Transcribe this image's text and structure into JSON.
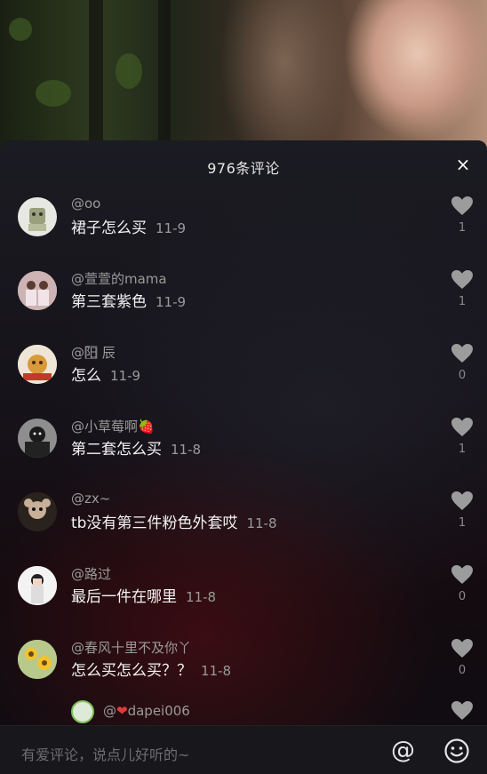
{
  "panel": {
    "title": "976条评论",
    "close_label": "×"
  },
  "comments": [
    {
      "username": "@oo",
      "text": "裙子怎么买",
      "date": "11-9",
      "likes": "1"
    },
    {
      "username": "@萱萱的mama",
      "text": "第三套紫色",
      "date": "11-9",
      "likes": "1"
    },
    {
      "username": "@阳⃞ 辰",
      "text": "怎么",
      "date": "11-9",
      "likes": "0"
    },
    {
      "username": "@小草莓啊🍓",
      "text": "第二套怎么买",
      "date": "11-8",
      "likes": "1"
    },
    {
      "username": "@zx~",
      "text": "tb没有第三件粉色外套哎",
      "date": "11-8",
      "likes": "1"
    },
    {
      "username": "@路过",
      "text": "最后一件在哪里",
      "date": "11-8",
      "likes": "0"
    },
    {
      "username": "@春风十里不及你丫",
      "text": "怎么买怎么买？？",
      "date": "11-8",
      "likes": "0"
    }
  ],
  "reply": {
    "prefix": "@",
    "heart": "❤",
    "name": "dapei006"
  },
  "input": {
    "placeholder": "有爱评论，说点儿好听的~",
    "at_label": "@"
  },
  "icons": {
    "like": "heart-icon",
    "close": "close-icon",
    "emoji": "smiley-icon",
    "mention": "at-icon"
  }
}
